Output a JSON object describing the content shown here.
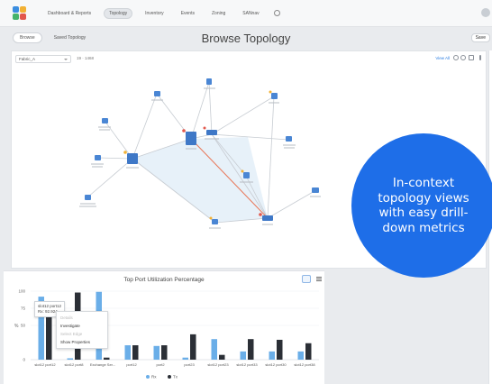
{
  "nav": {
    "tabs": [
      "Dashboard & Reports",
      "Topology",
      "Inventory",
      "Events",
      "Zoning",
      "SANnav"
    ],
    "active_tab": "Topology"
  },
  "subheader": {
    "browse_label": "Browse",
    "saved_label": "Saved Topology",
    "title": "Browse Topology",
    "save_label": "Save"
  },
  "topology": {
    "fabric_value": "Fabric_A",
    "meta_text": "19 · 1468",
    "view_all_label": "View All"
  },
  "promo": {
    "text": "In-context topology views with easy drill-down metrics"
  },
  "chart_data": {
    "type": "bar",
    "title": "Top Port Utilization Percentage",
    "ylabel": "%",
    "ylim": [
      0,
      100
    ],
    "yticks": [
      0,
      50,
      75,
      100
    ],
    "categories": [
      "slot12 port12",
      "slot12 port8",
      "Exchange Ser...",
      "port12",
      "port2",
      "port23",
      "slot12 port23",
      "slot12 port33",
      "slot12 port30",
      "slot12 port38"
    ],
    "series": [
      {
        "name": "Rx",
        "color": "#6aaee8",
        "values": [
          92,
          2,
          99,
          21,
          20,
          3,
          30,
          12,
          12,
          12
        ]
      },
      {
        "name": "Tx",
        "color": "#2b2f36",
        "values": [
          79,
          98,
          3,
          21,
          21,
          37,
          7,
          30,
          29,
          24
        ]
      }
    ],
    "legend": [
      "Rx",
      "Tx"
    ],
    "legend_position": "bottom"
  },
  "chart_ui": {
    "tooltip_line1": "slot12 port12",
    "tooltip_line2": "Rx: 92.924"
  },
  "context_menu": {
    "items": [
      {
        "label": "Details",
        "enabled": false
      },
      {
        "label": "Investigate",
        "enabled": true
      },
      {
        "label": "Select Edge",
        "enabled": false
      },
      {
        "label": "Show Properties",
        "enabled": true
      }
    ]
  },
  "colors": {
    "accent": "#1e6ee8",
    "rx": "#6aaee8",
    "tx": "#2b2f36",
    "link_highlight": "#e8785a"
  }
}
